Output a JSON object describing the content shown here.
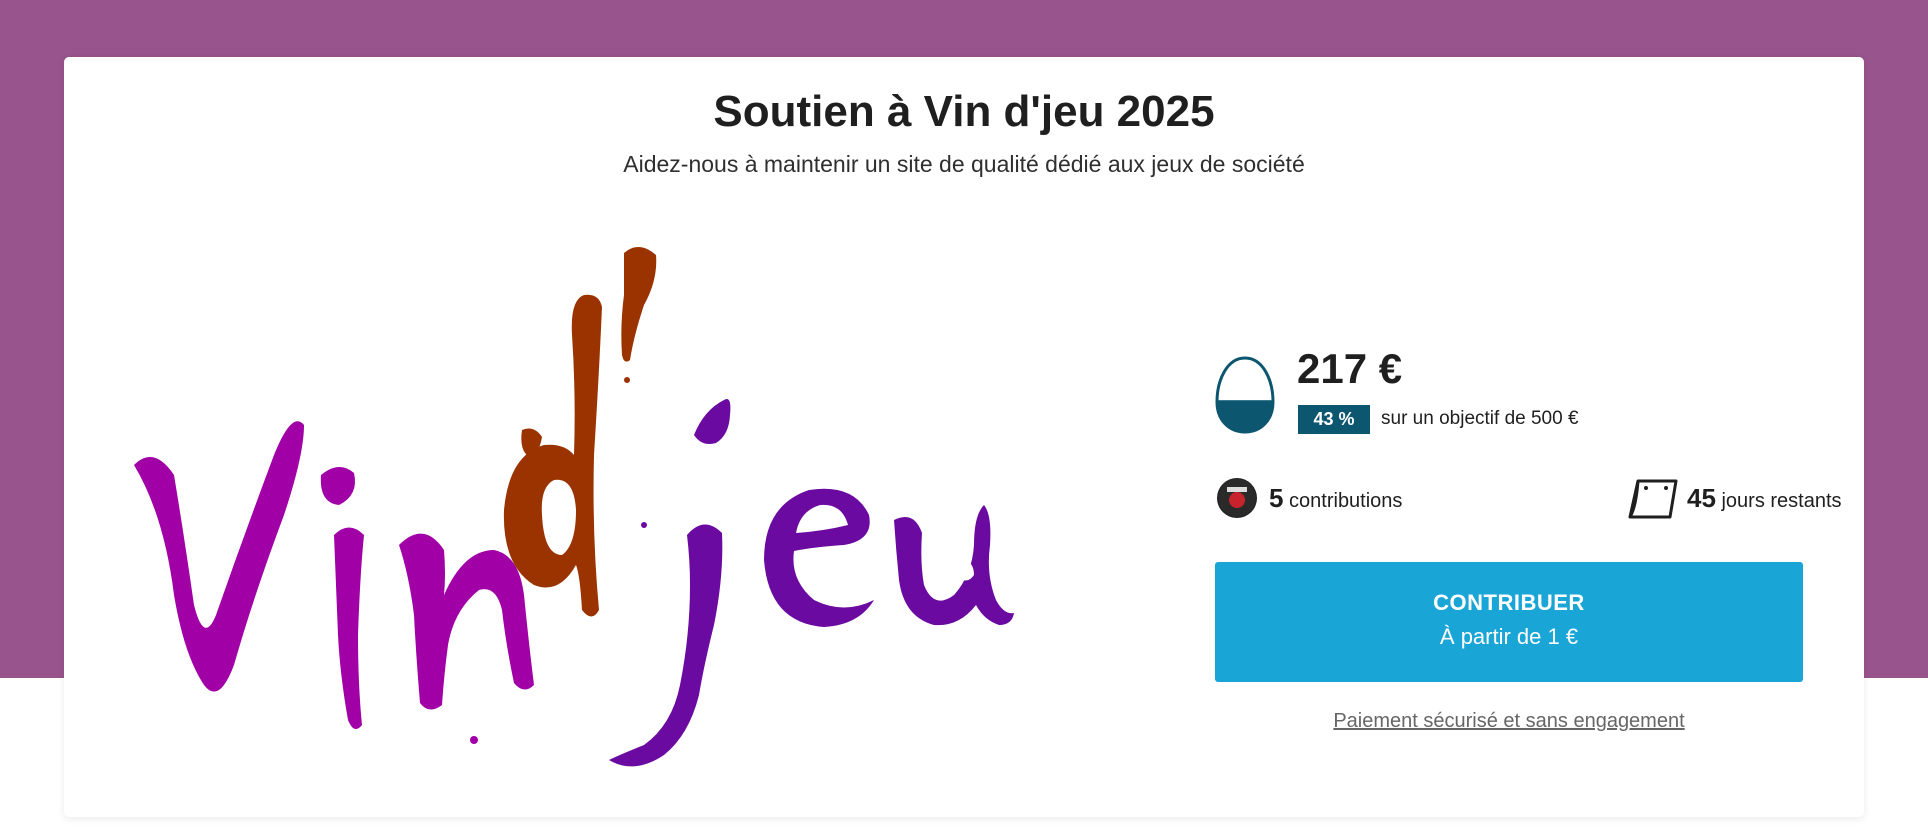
{
  "colors": {
    "brand_band": "#98548c",
    "accent_button": "#1aa5d7",
    "badge_bg": "#0d5670",
    "logo_purple_light": "#a100a6",
    "logo_orange": "#9a3300",
    "logo_purple_dark": "#6a0aa0"
  },
  "header": {
    "title": "Soutien à Vin d'jeu 2025",
    "subtitle": "Aidez-nous à maintenir un site de qualité dédié aux jeux de société"
  },
  "logo": {
    "text": "Vin d'jeu",
    "icon": "vin-djeu-logo"
  },
  "funding": {
    "amount": "217 €",
    "progress_percent": 43,
    "percent_label": "43 %",
    "goal_text": "sur un objectif de 500 €",
    "jar_icon": "piggy-jar-icon"
  },
  "stats": {
    "contributions_count": "5",
    "contributions_label": "contributions",
    "days_count": "45",
    "days_label": "jours restants",
    "avatar_icon": "contributor-avatar",
    "calendar_icon": "calendar-icon"
  },
  "cta": {
    "label": "CONTRIBUER",
    "sublabel": "À partir de 1 €"
  },
  "secure_link": "Paiement sécurisé et sans engagement"
}
